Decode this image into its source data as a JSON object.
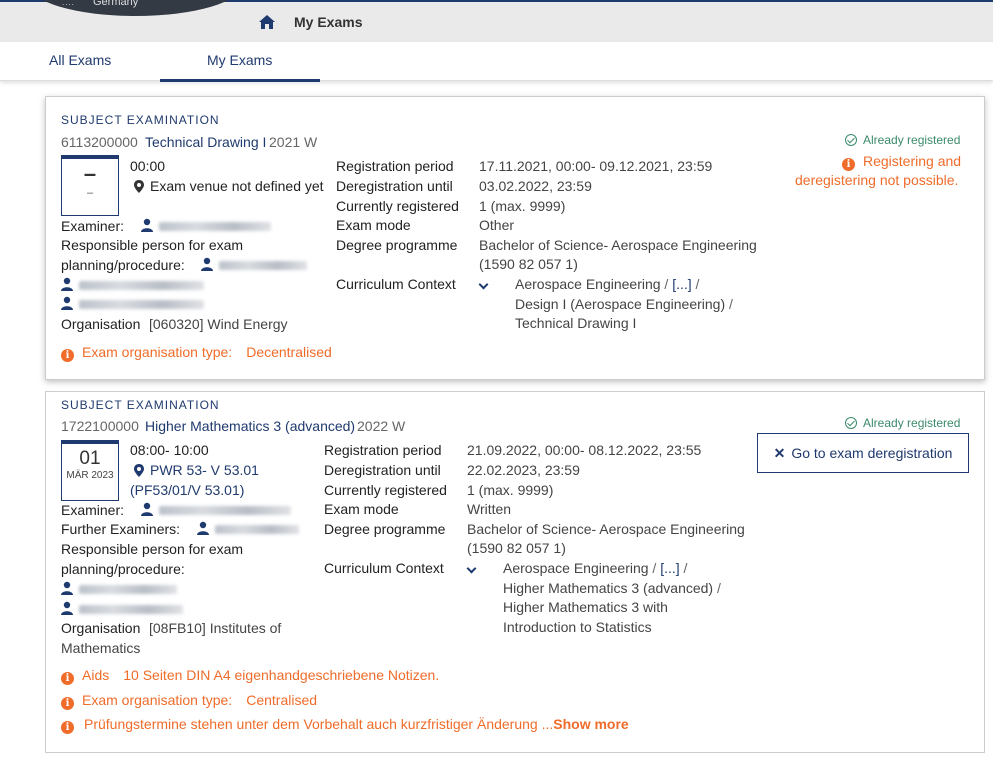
{
  "header": {
    "logo_text": "Germany",
    "breadcrumb": "My Exams"
  },
  "tabs": [
    {
      "label": "All Exams"
    },
    {
      "label": "My Exams"
    }
  ],
  "labels": {
    "registration_period": "Registration period",
    "deregistration_until": "Deregistration until",
    "currently_registered": "Currently registered",
    "exam_mode": "Exam mode",
    "degree_programme": "Degree programme",
    "curriculum_context": "Curriculum Context",
    "examiner": "Examiner:",
    "further_examiners": "Further Examiners:",
    "responsible_1": "Responsible person for exam",
    "responsible_2": "planning/procedure:",
    "organisation": "Organisation",
    "exam_org_type": "Exam organisation type:",
    "aids": "Aids",
    "already_registered": "Already registered"
  },
  "exams": [
    {
      "kind": "SUBJECT EXAMINATION",
      "number": "6113200000",
      "title": "Technical Drawing I",
      "term": "2021 W",
      "date_day": "–",
      "date_month": "–",
      "time": "00:00",
      "venue": "Exam venue not defined yet",
      "registration_period": "17.11.2021, 00:00- 09.12.2021, 23:59",
      "deregistration_until": "03.02.2022, 23:59",
      "currently_registered": "1 (max. 9999)",
      "exam_mode": "Other",
      "degree_programme_1": "Bachelor of Science- Aerospace Engineering",
      "degree_programme_2": "(1590 82 057 1)",
      "curriculum": [
        "Aerospace Engineering",
        "[...]",
        "Design I (Aerospace Engineering)",
        "Technical Drawing I"
      ],
      "organisation": "[060320] Wind Energy",
      "org_type": "Decentralised",
      "status": "Already registered",
      "warning_1": "Registering and",
      "warning_2": "deregistering not possible."
    },
    {
      "kind": "SUBJECT EXAMINATION",
      "number": "1722100000",
      "title": "Higher Mathematics 3 (advanced)",
      "term": "2022 W",
      "date_day": "01",
      "date_month": "MÄR 2023",
      "time": "08:00- 10:00",
      "venue": "PWR 53- V 53.01",
      "venue_2": "(PF53/01/V 53.01)",
      "registration_period": "21.09.2022, 00:00- 08.12.2022, 23:55",
      "deregistration_until": "22.02.2023, 23:59",
      "currently_registered": "1 (max. 9999)",
      "exam_mode": "Written",
      "degree_programme_1": "Bachelor of Science- Aerospace Engineering",
      "degree_programme_2": "(1590 82 057 1)",
      "curriculum": [
        "Aerospace Engineering",
        "[...]",
        "Higher Mathematics 3 (advanced)",
        "Higher Mathematics 3 with",
        "Introduction to Statistics"
      ],
      "organisation_1": "[08FB10] Institutes of",
      "organisation_2": "Mathematics",
      "aids": "10 Seiten DIN A4 eigenhandgeschriebene Notizen.",
      "org_type": "Centralised",
      "notice": "Prüfungstermine stehen unter dem Vorbehalt auch kurzfristiger Änderung ...",
      "show_more": "Show more",
      "status": "Already registered",
      "dereg_button": "Go to exam deregistration"
    }
  ],
  "colors": {
    "navy": "#1f3a6e",
    "orange": "#ef6c2a",
    "green": "#3a8a6a"
  }
}
